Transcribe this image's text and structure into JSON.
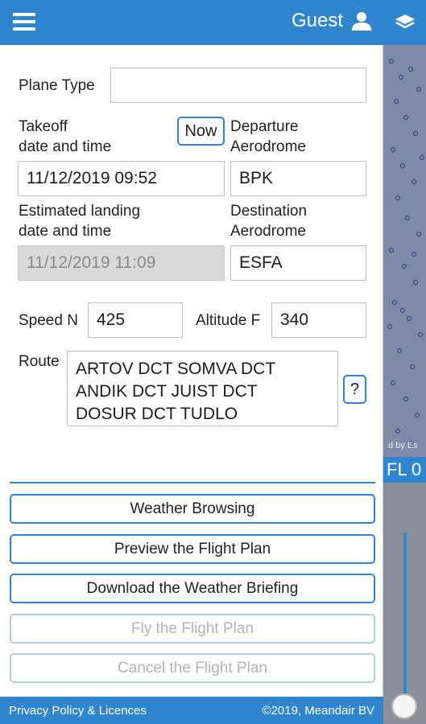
{
  "header": {
    "user_label": "Guest"
  },
  "form": {
    "plane_type": {
      "label": "Plane Type",
      "value": ""
    },
    "takeoff": {
      "label_line1": "Takeoff",
      "label_line2": "date and time",
      "value": "11/12/2019 09:52",
      "now_label": "Now"
    },
    "departure": {
      "label_line1": "Departure",
      "label_line2": "Aerodrome",
      "value": "BPK"
    },
    "landing": {
      "label_line1": "Estimated landing",
      "label_line2": "date and time",
      "value": "11/12/2019 11:09"
    },
    "destination": {
      "label_line1": "Destination",
      "label_line2": "Aerodrome",
      "value": "ESFA"
    },
    "speed": {
      "label": "Speed N",
      "value": "425"
    },
    "altitude": {
      "label": "Altitude F",
      "value": "340"
    },
    "route": {
      "label": "Route",
      "lines": [
        "ARTOV DCT SOMVA DCT",
        "ANDIK DCT JUIST DCT",
        "DOSUR DCT TUDLO"
      ],
      "help_label": "?"
    }
  },
  "actions": {
    "weather_browsing": "Weather Browsing",
    "preview": "Preview the Flight Plan",
    "download_briefing": "Download the Weather Briefing",
    "fly": "Fly the Flight Plan",
    "cancel": "Cancel the Flight Plan"
  },
  "map": {
    "attribution": "d by Es",
    "flight_level": "FL 0"
  },
  "footer": {
    "privacy_link": "Privacy Policy & Licences",
    "copyright": "©2019, Meandair BV"
  },
  "colors": {
    "accent": "#2f86cf",
    "disabled_field": "#d9d9d9"
  }
}
